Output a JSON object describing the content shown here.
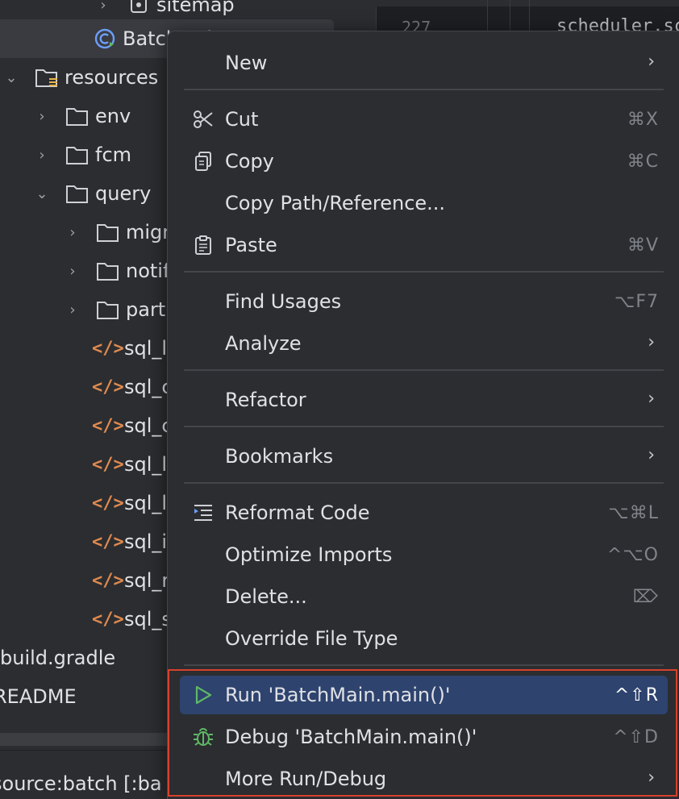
{
  "tree": {
    "items": [
      {
        "label": "sitemap",
        "type": "package"
      },
      {
        "label": "BatchMain",
        "type": "java-class"
      },
      {
        "label": "resources",
        "type": "resources-folder"
      },
      {
        "label": "env",
        "type": "folder"
      },
      {
        "label": "fcm",
        "type": "folder"
      },
      {
        "label": "query",
        "type": "folder"
      },
      {
        "label": "migr",
        "type": "folder"
      },
      {
        "label": "notif",
        "type": "folder"
      },
      {
        "label": "partn",
        "type": "folder"
      },
      {
        "label": "sql_l",
        "type": "xml"
      },
      {
        "label": "sql_c",
        "type": "xml"
      },
      {
        "label": "sql_c",
        "type": "xml"
      },
      {
        "label": "sql_l",
        "type": "xml"
      },
      {
        "label": "sql_l",
        "type": "xml"
      },
      {
        "label": "sql_i",
        "type": "xml"
      },
      {
        "label": "sql_r",
        "type": "xml"
      },
      {
        "label": "sql_s",
        "type": "xml"
      },
      {
        "label": "build.gradle",
        "type": "file"
      },
      {
        "label": "README",
        "type": "file"
      }
    ]
  },
  "editor": {
    "line_number": "227",
    "code": "scheduler.sc"
  },
  "statusbar": {
    "text": "source:batch [:ba"
  },
  "menu": {
    "new": {
      "label": "New",
      "submenu": true
    },
    "cut": {
      "label": "Cut",
      "shortcut": "⌘X",
      "icon": "scissors-icon"
    },
    "copy": {
      "label": "Copy",
      "shortcut": "⌘C",
      "icon": "copy-icon"
    },
    "copy_path": {
      "label": "Copy Path/Reference..."
    },
    "paste": {
      "label": "Paste",
      "shortcut": "⌘V",
      "icon": "paste-icon"
    },
    "find_usages": {
      "label": "Find Usages",
      "shortcut": "⌥F7"
    },
    "analyze": {
      "label": "Analyze",
      "submenu": true
    },
    "refactor": {
      "label": "Refactor",
      "submenu": true
    },
    "bookmarks": {
      "label": "Bookmarks",
      "submenu": true
    },
    "reformat": {
      "label": "Reformat Code",
      "shortcut": "⌥⌘L",
      "icon": "reformat-icon"
    },
    "optimize": {
      "label": "Optimize Imports",
      "shortcut": "^⌥O"
    },
    "delete": {
      "label": "Delete...",
      "shortcut": "⌦"
    },
    "override": {
      "label": "Override File Type"
    },
    "run": {
      "label": "Run 'BatchMain.main()'",
      "shortcut": "^⇧R",
      "icon": "run-icon"
    },
    "debug": {
      "label": "Debug 'BatchMain.main()'",
      "shortcut": "^⇧D",
      "icon": "debug-icon"
    },
    "more": {
      "label": "More Run/Debug",
      "submenu": true
    }
  },
  "colors": {
    "highlight_border": "#d9412e",
    "active_item": "#2e436e",
    "run_green": "#5fb865",
    "xml_orange": "#e08a4f"
  }
}
